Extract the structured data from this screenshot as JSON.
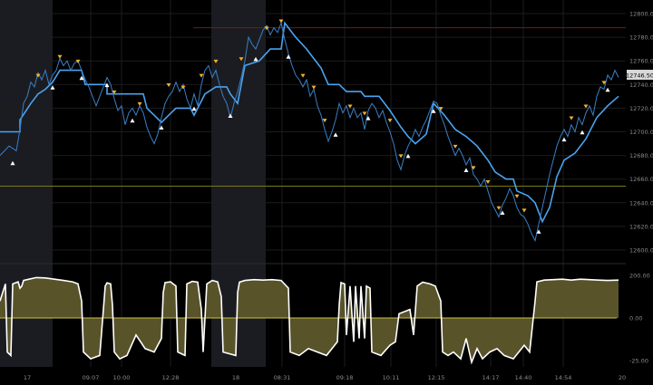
{
  "colors": {
    "background": "#000000",
    "session_shade": "#1a1c22",
    "grid": "#1c1c1c",
    "price_line": "#3a7fc4",
    "trail_stop": "#4aa3f0",
    "sell_marker": "#f0b030",
    "buy_marker": "#ffffff",
    "resistance_line": "#7a1818",
    "support_line": "#7a7a10",
    "osc_fill": "#59532a",
    "osc_line": "#ffffff",
    "osc_zero": "#c9c04a",
    "axis_text": "#8a8a8a",
    "price_tag_bg": "#d8d8d8",
    "price_tag_text": "#000000"
  },
  "price_axis": {
    "ticks": [
      "12800.00",
      "12780.00",
      "12760.00",
      "12740.00",
      "12720.00",
      "12700.00",
      "12680.00",
      "12660.00",
      "12640.00",
      "12620.00",
      "12600.00"
    ],
    "last_price_label": "12746.50"
  },
  "oscillator_axis": {
    "ticks": [
      "200.00",
      "0.00",
      "-25.00"
    ]
  },
  "time_axis": {
    "labels": [
      "17",
      "09:07",
      "10:00",
      "12:28",
      "18",
      "08:31",
      "09:18",
      "10:11",
      "12:15",
      "14:17",
      "14:40",
      "14:54",
      "20"
    ]
  },
  "chart_data": {
    "type": "line",
    "title": "",
    "xlabel": "",
    "ylabel": "",
    "ylim": [
      12600,
      12800
    ],
    "resistance_level": 12788,
    "support_level": 12654,
    "price": [
      [
        0,
        12680
      ],
      [
        10,
        12688
      ],
      [
        18,
        12684
      ],
      [
        22,
        12702
      ],
      [
        26,
        12724
      ],
      [
        30,
        12730
      ],
      [
        34,
        12742
      ],
      [
        38,
        12738
      ],
      [
        42,
        12750
      ],
      [
        46,
        12744
      ],
      [
        50,
        12752
      ],
      [
        54,
        12740
      ],
      [
        58,
        12748
      ],
      [
        62,
        12752
      ],
      [
        66,
        12762
      ],
      [
        70,
        12756
      ],
      [
        74,
        12760
      ],
      [
        78,
        12752
      ],
      [
        82,
        12758
      ],
      [
        86,
        12760
      ],
      [
        90,
        12752
      ],
      [
        94,
        12744
      ],
      [
        98,
        12738
      ],
      [
        102,
        12730
      ],
      [
        106,
        12722
      ],
      [
        110,
        12730
      ],
      [
        114,
        12738
      ],
      [
        118,
        12746
      ],
      [
        122,
        12740
      ],
      [
        126,
        12728
      ],
      [
        130,
        12718
      ],
      [
        134,
        12722
      ],
      [
        138,
        12706
      ],
      [
        142,
        12716
      ],
      [
        146,
        12720
      ],
      [
        150,
        12714
      ],
      [
        154,
        12722
      ],
      [
        158,
        12716
      ],
      [
        162,
        12704
      ],
      [
        166,
        12696
      ],
      [
        170,
        12690
      ],
      [
        174,
        12698
      ],
      [
        178,
        12712
      ],
      [
        182,
        12724
      ],
      [
        186,
        12730
      ],
      [
        190,
        12734
      ],
      [
        194,
        12742
      ],
      [
        198,
        12734
      ],
      [
        202,
        12740
      ],
      [
        206,
        12728
      ],
      [
        210,
        12720
      ],
      [
        214,
        12732
      ],
      [
        218,
        12722
      ],
      [
        222,
        12740
      ],
      [
        226,
        12752
      ],
      [
        230,
        12756
      ],
      [
        234,
        12746
      ],
      [
        238,
        12752
      ],
      [
        242,
        12740
      ],
      [
        246,
        12730
      ],
      [
        250,
        12724
      ],
      [
        254,
        12712
      ],
      [
        258,
        12724
      ],
      [
        262,
        12734
      ],
      [
        266,
        12746
      ],
      [
        270,
        12760
      ],
      [
        274,
        12780
      ],
      [
        278,
        12774
      ],
      [
        282,
        12770
      ],
      [
        286,
        12778
      ],
      [
        290,
        12786
      ],
      [
        294,
        12790
      ],
      [
        298,
        12782
      ],
      [
        302,
        12788
      ],
      [
        306,
        12784
      ],
      [
        310,
        12792
      ],
      [
        314,
        12778
      ],
      [
        318,
        12766
      ],
      [
        322,
        12756
      ],
      [
        326,
        12748
      ],
      [
        330,
        12744
      ],
      [
        334,
        12738
      ],
      [
        338,
        12744
      ],
      [
        342,
        12730
      ],
      [
        346,
        12736
      ],
      [
        350,
        12722
      ],
      [
        354,
        12714
      ],
      [
        358,
        12702
      ],
      [
        362,
        12692
      ],
      [
        366,
        12700
      ],
      [
        370,
        12710
      ],
      [
        374,
        12724
      ],
      [
        378,
        12716
      ],
      [
        382,
        12722
      ],
      [
        386,
        12712
      ],
      [
        390,
        12720
      ],
      [
        394,
        12712
      ],
      [
        398,
        12716
      ],
      [
        402,
        12702
      ],
      [
        406,
        12718
      ],
      [
        410,
        12724
      ],
      [
        414,
        12720
      ],
      [
        418,
        12712
      ],
      [
        422,
        12718
      ],
      [
        426,
        12708
      ],
      [
        430,
        12700
      ],
      [
        434,
        12690
      ],
      [
        438,
        12676
      ],
      [
        442,
        12668
      ],
      [
        446,
        12680
      ],
      [
        450,
        12688
      ],
      [
        454,
        12694
      ],
      [
        458,
        12702
      ],
      [
        462,
        12696
      ],
      [
        466,
        12704
      ],
      [
        470,
        12710
      ],
      [
        474,
        12718
      ],
      [
        478,
        12726
      ],
      [
        482,
        12724
      ],
      [
        486,
        12714
      ],
      [
        490,
        12706
      ],
      [
        494,
        12696
      ],
      [
        498,
        12688
      ],
      [
        502,
        12680
      ],
      [
        506,
        12686
      ],
      [
        510,
        12680
      ],
      [
        514,
        12672
      ],
      [
        518,
        12678
      ],
      [
        522,
        12664
      ],
      [
        526,
        12660
      ],
      [
        530,
        12654
      ],
      [
        534,
        12660
      ],
      [
        538,
        12650
      ],
      [
        542,
        12640
      ],
      [
        546,
        12634
      ],
      [
        550,
        12628
      ],
      [
        554,
        12638
      ],
      [
        558,
        12644
      ],
      [
        562,
        12652
      ],
      [
        566,
        12646
      ],
      [
        570,
        12636
      ],
      [
        574,
        12630
      ],
      [
        578,
        12628
      ],
      [
        582,
        12622
      ],
      [
        586,
        12614
      ],
      [
        590,
        12608
      ],
      [
        594,
        12622
      ],
      [
        598,
        12636
      ],
      [
        602,
        12650
      ],
      [
        606,
        12664
      ],
      [
        610,
        12676
      ],
      [
        614,
        12688
      ],
      [
        618,
        12696
      ],
      [
        622,
        12702
      ],
      [
        626,
        12696
      ],
      [
        630,
        12706
      ],
      [
        634,
        12700
      ],
      [
        638,
        12712
      ],
      [
        642,
        12706
      ],
      [
        646,
        12716
      ],
      [
        650,
        12722
      ],
      [
        654,
        12714
      ],
      [
        658,
        12730
      ],
      [
        662,
        12738
      ],
      [
        666,
        12736
      ],
      [
        670,
        12748
      ],
      [
        674,
        12744
      ],
      [
        678,
        12752
      ],
      [
        682,
        12746
      ]
    ],
    "trail_stop": [
      [
        0,
        12700
      ],
      [
        22,
        12700
      ],
      [
        22,
        12710
      ],
      [
        34,
        12724
      ],
      [
        42,
        12732
      ],
      [
        50,
        12736
      ],
      [
        58,
        12742
      ],
      [
        66,
        12752
      ],
      [
        90,
        12752
      ],
      [
        94,
        12740
      ],
      [
        118,
        12740
      ],
      [
        118,
        12732
      ],
      [
        138,
        12732
      ],
      [
        158,
        12732
      ],
      [
        162,
        12720
      ],
      [
        170,
        12714
      ],
      [
        178,
        12708
      ],
      [
        186,
        12714
      ],
      [
        194,
        12720
      ],
      [
        210,
        12720
      ],
      [
        214,
        12714
      ],
      [
        226,
        12732
      ],
      [
        238,
        12738
      ],
      [
        250,
        12738
      ],
      [
        254,
        12732
      ],
      [
        262,
        12724
      ],
      [
        270,
        12756
      ],
      [
        286,
        12760
      ],
      [
        298,
        12770
      ],
      [
        310,
        12770
      ],
      [
        314,
        12792
      ],
      [
        326,
        12780
      ],
      [
        338,
        12770
      ],
      [
        346,
        12762
      ],
      [
        354,
        12754
      ],
      [
        362,
        12740
      ],
      [
        374,
        12740
      ],
      [
        382,
        12734
      ],
      [
        398,
        12734
      ],
      [
        402,
        12730
      ],
      [
        418,
        12730
      ],
      [
        430,
        12718
      ],
      [
        442,
        12704
      ],
      [
        450,
        12696
      ],
      [
        458,
        12690
      ],
      [
        470,
        12698
      ],
      [
        478,
        12724
      ],
      [
        490,
        12714
      ],
      [
        502,
        12702
      ],
      [
        514,
        12696
      ],
      [
        526,
        12688
      ],
      [
        538,
        12676
      ],
      [
        546,
        12666
      ],
      [
        558,
        12660
      ],
      [
        566,
        12660
      ],
      [
        570,
        12650
      ],
      [
        582,
        12646
      ],
      [
        590,
        12640
      ],
      [
        598,
        12624
      ],
      [
        606,
        12636
      ],
      [
        614,
        12662
      ],
      [
        622,
        12676
      ],
      [
        634,
        12682
      ],
      [
        646,
        12694
      ],
      [
        658,
        12712
      ],
      [
        670,
        12722
      ],
      [
        682,
        12730
      ]
    ],
    "sell_markers": [
      [
        42,
        12744
      ],
      [
        66,
        12760
      ],
      [
        86,
        12756
      ],
      [
        126,
        12730
      ],
      [
        154,
        12720
      ],
      [
        186,
        12736
      ],
      [
        202,
        12734
      ],
      [
        222,
        12744
      ],
      [
        238,
        12756
      ],
      [
        266,
        12758
      ],
      [
        294,
        12784
      ],
      [
        310,
        12790
      ],
      [
        334,
        12744
      ],
      [
        346,
        12734
      ],
      [
        358,
        12706
      ],
      [
        386,
        12718
      ],
      [
        402,
        12712
      ],
      [
        430,
        12706
      ],
      [
        442,
        12676
      ],
      [
        486,
        12716
      ],
      [
        502,
        12684
      ],
      [
        522,
        12666
      ],
      [
        538,
        12654
      ],
      [
        550,
        12632
      ],
      [
        570,
        12642
      ],
      [
        578,
        12630
      ],
      [
        630,
        12708
      ],
      [
        646,
        12718
      ],
      [
        666,
        12738
      ]
    ],
    "buy_markers": [
      [
        14,
        12678
      ],
      [
        58,
        12742
      ],
      [
        90,
        12750
      ],
      [
        118,
        12744
      ],
      [
        146,
        12714
      ],
      [
        178,
        12708
      ],
      [
        214,
        12724
      ],
      [
        254,
        12718
      ],
      [
        282,
        12766
      ],
      [
        318,
        12768
      ],
      [
        370,
        12702
      ],
      [
        406,
        12716
      ],
      [
        450,
        12684
      ],
      [
        478,
        12722
      ],
      [
        514,
        12672
      ],
      [
        554,
        12636
      ],
      [
        594,
        12620
      ],
      [
        622,
        12698
      ],
      [
        642,
        12704
      ],
      [
        670,
        12740
      ]
    ],
    "oscillator": [
      [
        0,
        80
      ],
      [
        6,
        160
      ],
      [
        8,
        -20
      ],
      [
        12,
        -22
      ],
      [
        14,
        160
      ],
      [
        20,
        170
      ],
      [
        22,
        140
      ],
      [
        24,
        150
      ],
      [
        26,
        176
      ],
      [
        32,
        182
      ],
      [
        40,
        190
      ],
      [
        50,
        188
      ],
      [
        60,
        182
      ],
      [
        70,
        176
      ],
      [
        80,
        170
      ],
      [
        86,
        160
      ],
      [
        90,
        80
      ],
      [
        92,
        -20
      ],
      [
        100,
        -24
      ],
      [
        110,
        -22
      ],
      [
        114,
        40
      ],
      [
        116,
        150
      ],
      [
        118,
        165
      ],
      [
        122,
        160
      ],
      [
        124,
        60
      ],
      [
        126,
        -20
      ],
      [
        132,
        -24
      ],
      [
        140,
        -22
      ],
      [
        150,
        -10
      ],
      [
        160,
        -18
      ],
      [
        170,
        -20
      ],
      [
        178,
        -12
      ],
      [
        180,
        120
      ],
      [
        182,
        166
      ],
      [
        188,
        170
      ],
      [
        194,
        150
      ],
      [
        196,
        -20
      ],
      [
        204,
        -22
      ],
      [
        206,
        160
      ],
      [
        212,
        172
      ],
      [
        218,
        168
      ],
      [
        222,
        40
      ],
      [
        224,
        -20
      ],
      [
        228,
        160
      ],
      [
        234,
        176
      ],
      [
        240,
        170
      ],
      [
        244,
        100
      ],
      [
        246,
        -20
      ],
      [
        260,
        -22
      ],
      [
        262,
        120
      ],
      [
        264,
        168
      ],
      [
        270,
        176
      ],
      [
        280,
        180
      ],
      [
        290,
        178
      ],
      [
        300,
        180
      ],
      [
        310,
        176
      ],
      [
        318,
        140
      ],
      [
        320,
        -20
      ],
      [
        330,
        -22
      ],
      [
        340,
        -18
      ],
      [
        350,
        -20
      ],
      [
        360,
        -22
      ],
      [
        372,
        -14
      ],
      [
        374,
        60
      ],
      [
        376,
        166
      ],
      [
        380,
        160
      ],
      [
        382,
        -10
      ],
      [
        386,
        150
      ],
      [
        390,
        -14
      ],
      [
        392,
        150
      ],
      [
        396,
        -12
      ],
      [
        398,
        150
      ],
      [
        402,
        -12
      ],
      [
        404,
        150
      ],
      [
        408,
        140
      ],
      [
        410,
        -20
      ],
      [
        420,
        -22
      ],
      [
        430,
        -16
      ],
      [
        436,
        -14
      ],
      [
        440,
        20
      ],
      [
        452,
        40
      ],
      [
        456,
        -10
      ],
      [
        460,
        150
      ],
      [
        466,
        168
      ],
      [
        474,
        160
      ],
      [
        480,
        150
      ],
      [
        486,
        80
      ],
      [
        488,
        -20
      ],
      [
        494,
        -22
      ],
      [
        500,
        -20
      ],
      [
        508,
        -24
      ],
      [
        514,
        -12
      ],
      [
        520,
        -26
      ],
      [
        526,
        -18
      ],
      [
        532,
        -24
      ],
      [
        540,
        -20
      ],
      [
        548,
        -18
      ],
      [
        556,
        -22
      ],
      [
        566,
        -24
      ],
      [
        572,
        -20
      ],
      [
        578,
        -16
      ],
      [
        584,
        -20
      ],
      [
        590,
        80
      ],
      [
        592,
        170
      ],
      [
        600,
        178
      ],
      [
        610,
        180
      ],
      [
        620,
        182
      ],
      [
        630,
        178
      ],
      [
        640,
        182
      ],
      [
        650,
        180
      ],
      [
        660,
        178
      ],
      [
        670,
        176
      ],
      [
        682,
        178
      ]
    ]
  }
}
